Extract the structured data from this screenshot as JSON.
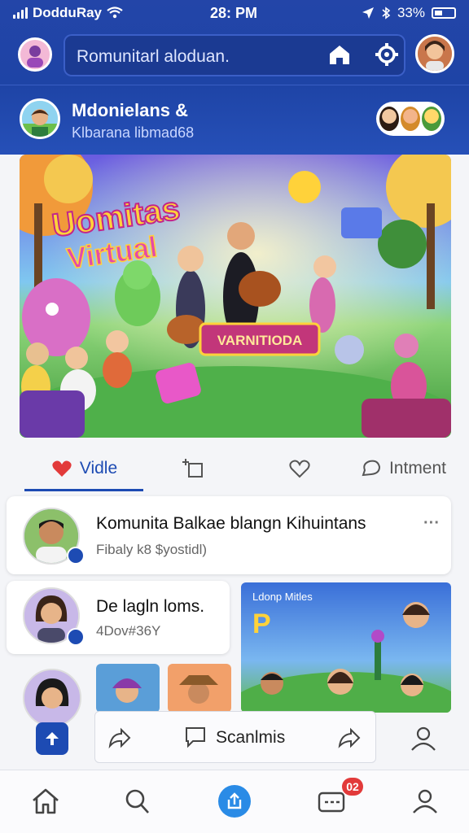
{
  "status": {
    "carrier": "DodduRay",
    "time": "28: PM",
    "battery": "33%"
  },
  "header": {
    "search_placeholder": "Romunitarl aloduan."
  },
  "group": {
    "title": "Mdonielans &",
    "subtitle": "Klbarana libmad68"
  },
  "hero": {
    "title_line1": "Uomitas",
    "title_line2": "Virtual",
    "banner": "VARNITIODA"
  },
  "actions": {
    "tab1": "Vidle",
    "tab4": "Intment"
  },
  "post": {
    "title": "Komunita Balkae blangn Kihuintans",
    "subtitle": "Fibaly k8 $yostidl)",
    "more": "···"
  },
  "post2": {
    "title": "De lagln loms.",
    "subtitle": "4Dov#36Y"
  },
  "media_card": {
    "label": "Ldonp Mitles",
    "letter": "P"
  },
  "sharebar": {
    "label": "Scanlmis"
  },
  "nav": {
    "notif_count": "02"
  },
  "colors": {
    "primary": "#1d4bb3",
    "header": "#2345a8",
    "accent": "#2a8be6",
    "badge": "#e23a3a"
  },
  "icons": [
    "home-icon",
    "settings-icon",
    "heart-icon",
    "comment-icon",
    "share-icon",
    "search-icon",
    "profile-icon"
  ]
}
